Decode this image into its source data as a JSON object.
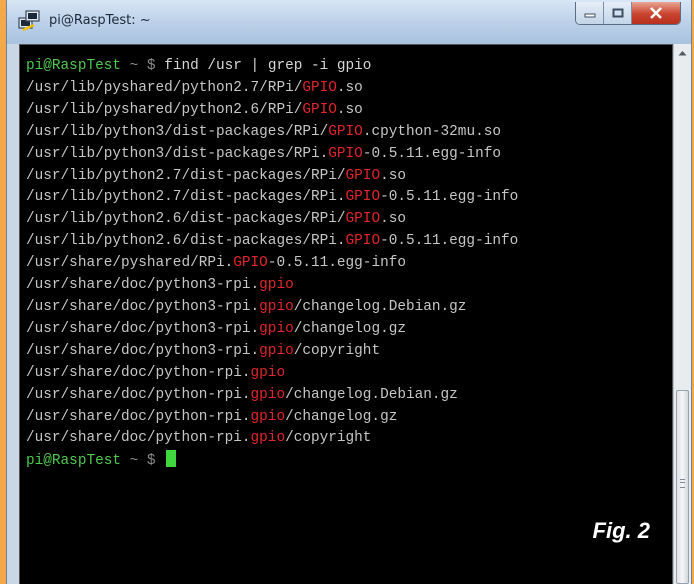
{
  "window": {
    "title": "pi@RaspTest: ~",
    "icon": "putty-icon",
    "controls": [
      "minimize-icon",
      "maximize-icon",
      "close-icon"
    ]
  },
  "terminal": {
    "prompt_user": "pi@RaspTest",
    "prompt_path": " ~ $ ",
    "command": "find /usr | grep -i gpio",
    "output": [
      {
        "pre": "/usr/lib/pyshared/python2.7/RPi/",
        "match": "GPIO",
        "post": ".so"
      },
      {
        "pre": "/usr/lib/pyshared/python2.6/RPi/",
        "match": "GPIO",
        "post": ".so"
      },
      {
        "pre": "/usr/lib/python3/dist-packages/RPi/",
        "match": "GPIO",
        "post": ".cpython-32mu.so"
      },
      {
        "pre": "/usr/lib/python3/dist-packages/RPi.",
        "match": "GPIO",
        "post": "-0.5.11.egg-info"
      },
      {
        "pre": "/usr/lib/python2.7/dist-packages/RPi/",
        "match": "GPIO",
        "post": ".so"
      },
      {
        "pre": "/usr/lib/python2.7/dist-packages/RPi.",
        "match": "GPIO",
        "post": "-0.5.11.egg-info"
      },
      {
        "pre": "/usr/lib/python2.6/dist-packages/RPi/",
        "match": "GPIO",
        "post": ".so"
      },
      {
        "pre": "/usr/lib/python2.6/dist-packages/RPi.",
        "match": "GPIO",
        "post": "-0.5.11.egg-info"
      },
      {
        "pre": "/usr/share/pyshared/RPi.",
        "match": "GPIO",
        "post": "-0.5.11.egg-info"
      },
      {
        "pre": "/usr/share/doc/python3-rpi.",
        "match": "gpio",
        "post": ""
      },
      {
        "pre": "/usr/share/doc/python3-rpi.",
        "match": "gpio",
        "post": "/changelog.Debian.gz"
      },
      {
        "pre": "/usr/share/doc/python3-rpi.",
        "match": "gpio",
        "post": "/changelog.gz"
      },
      {
        "pre": "/usr/share/doc/python3-rpi.",
        "match": "gpio",
        "post": "/copyright"
      },
      {
        "pre": "/usr/share/doc/python-rpi.",
        "match": "gpio",
        "post": ""
      },
      {
        "pre": "/usr/share/doc/python-rpi.",
        "match": "gpio",
        "post": "/changelog.Debian.gz"
      },
      {
        "pre": "/usr/share/doc/python-rpi.",
        "match": "gpio",
        "post": "/changelog.gz"
      },
      {
        "pre": "/usr/share/doc/python-rpi.",
        "match": "gpio",
        "post": "/copyright"
      }
    ]
  },
  "figure_label": "Fig. 2",
  "colors": {
    "prompt": "#4ec94e",
    "match": "#e0262b",
    "text": "#c6c6c6",
    "background": "#000000",
    "cursor": "#3fd63f"
  }
}
